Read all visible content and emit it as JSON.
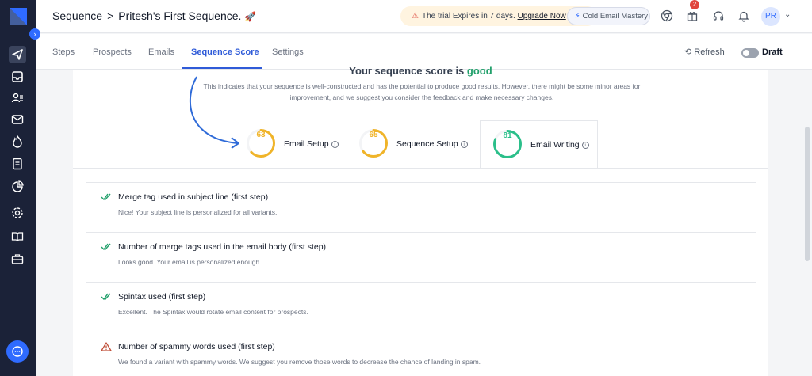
{
  "header": {
    "breadcrumb_root": "Sequence",
    "breadcrumb_sep": ">",
    "sequence_name": "Pritesh's First Sequence.",
    "trial_text": "The trial Expires in 7 days.",
    "trial_link": "Upgrade Now",
    "workspace": "Cold Email Mastery",
    "notification_count": "2",
    "avatar_initials": "PR"
  },
  "tabs": {
    "items": [
      "Steps",
      "Prospects",
      "Emails",
      "Sequence Score",
      "Settings"
    ],
    "active": "Sequence Score",
    "refresh_label": "Refresh",
    "draft_label": "Draft"
  },
  "score": {
    "heading_prefix": "Your sequence score is",
    "heading_value": "good",
    "description": "This indicates that your sequence is well-constructed and has the potential to produce good results. However, there might be some minor areas for improvement, and we suggest you consider the feedback and make necessary changes.",
    "categories": [
      {
        "label": "Email Setup",
        "value": "63",
        "fraction": 0.63,
        "color": "#f0b429"
      },
      {
        "label": "Sequence Setup",
        "value": "65",
        "fraction": 0.65,
        "color": "#f0b429"
      },
      {
        "label": "Email Writing",
        "value": "81",
        "fraction": 0.81,
        "color": "#2bbf8a"
      }
    ],
    "info_glyph": "i"
  },
  "checks": [
    {
      "status": "pass",
      "title": "Merge tag used in subject line (first step)",
      "desc": "Nice! Your subject line is personalized for all variants."
    },
    {
      "status": "pass",
      "title": "Number of merge tags used in the email body (first step)",
      "desc": "Looks good. Your email is personalized enough."
    },
    {
      "status": "pass",
      "title": "Spintax used (first step)",
      "desc": "Excellent. The Spintax would rotate email content for prospects."
    },
    {
      "status": "warn",
      "title": "Number of spammy words used (first step)",
      "desc": "We found a variant with spammy words. We suggest you remove those words to decrease the chance of landing in spam."
    }
  ],
  "colors": {
    "sidebar": "#1b2238",
    "accent": "#2f5bd8",
    "pass": "#22a06b",
    "warn": "#c0503a"
  },
  "icons": {
    "sidebar": [
      "send-icon",
      "inbox-icon",
      "prospects-icon",
      "mail-check-icon",
      "fire-icon",
      "document-icon",
      "pie-chart-icon",
      "gear-icon",
      "book-icon",
      "briefcase-icon"
    ],
    "header": [
      "chrome-icon",
      "gift-icon",
      "headset-icon",
      "bell-icon"
    ]
  }
}
